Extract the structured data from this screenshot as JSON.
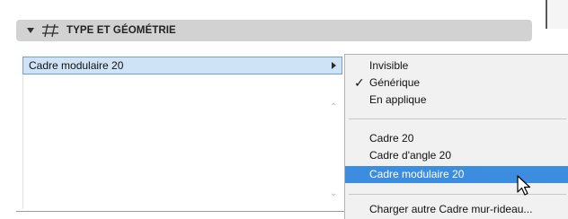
{
  "panel": {
    "title": "TYPE ET GÉOMÉTRIE",
    "field_value": "Cadre modulaire 20"
  },
  "menu": {
    "items": [
      {
        "label": "Invisible",
        "checked": false,
        "selected": false
      },
      {
        "label": "Générique",
        "checked": true,
        "selected": false
      },
      {
        "label": "En applique",
        "checked": false,
        "selected": false
      },
      {
        "label": "Cadre 20",
        "checked": false,
        "selected": false
      },
      {
        "label": "Cadre d'angle 20",
        "checked": false,
        "selected": false
      },
      {
        "label": "Cadre modulaire 20",
        "checked": false,
        "selected": true
      },
      {
        "label": "Charger autre Cadre mur-rideau...",
        "checked": false,
        "selected": false
      }
    ],
    "checkmark_glyph": "✓"
  },
  "colors": {
    "header_bg": "#d2d2d2",
    "field_bg": "#cfe3f7",
    "field_border": "#6f9fd6",
    "menu_bg": "#f1f1f1",
    "menu_highlight": "#3c8de0"
  },
  "icons": [
    "chevron-down-icon",
    "curtain-wall-grid-icon",
    "submenu-arrow-icon",
    "scroll-up-icon",
    "scroll-down-icon",
    "checkmark-icon",
    "mouse-pointer-icon"
  ]
}
